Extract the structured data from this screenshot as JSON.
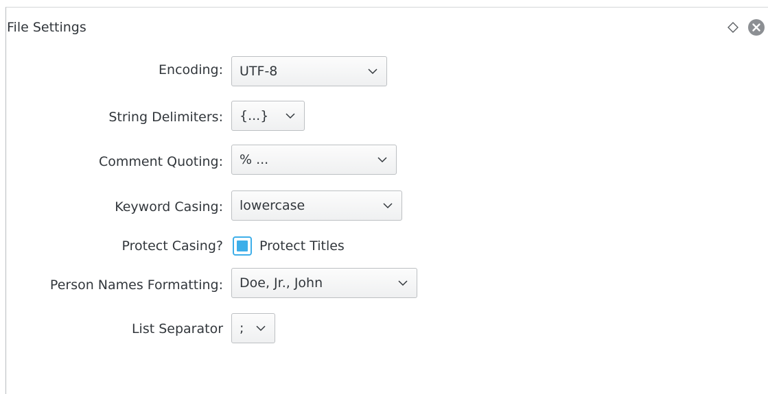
{
  "panel": {
    "title": "File Settings"
  },
  "fields": {
    "encoding": {
      "label": "Encoding:",
      "value": "UTF-8"
    },
    "string_delimiters": {
      "label": "String Delimiters:",
      "value": "{...}"
    },
    "comment_quoting": {
      "label": "Comment Quoting:",
      "value": "% ..."
    },
    "keyword_casing": {
      "label": "Keyword Casing:",
      "value": "lowercase"
    },
    "protect_casing": {
      "label": "Protect Casing?",
      "checkbox_label": "Protect Titles",
      "checked": true
    },
    "person_names": {
      "label": "Person Names Formatting:",
      "value": "Doe, Jr., John"
    },
    "list_separator": {
      "label": "List Separator",
      "value": ";"
    }
  },
  "icons": {
    "float": "diamond-icon",
    "close": "close-circle-icon"
  },
  "colors": {
    "accent": "#3daee9",
    "text": "#31363b",
    "close_icon": "#8c8f93"
  }
}
